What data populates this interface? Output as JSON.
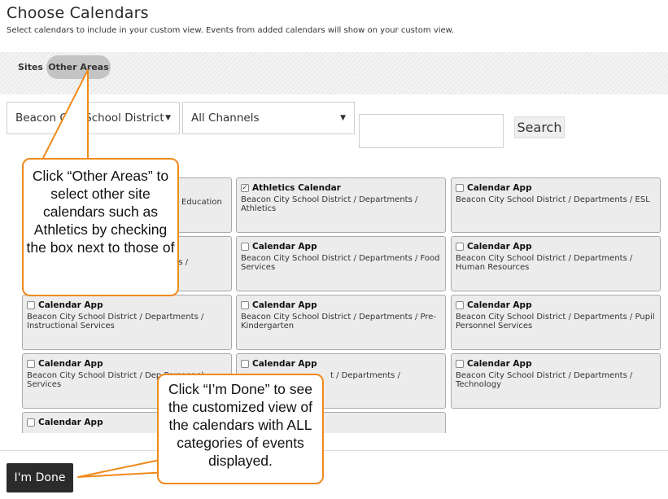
{
  "header": {
    "title": "Choose Calendars",
    "subtitle": "Select calendars to include in your custom view. Events from added calendars will show on your custom view."
  },
  "tabs": [
    {
      "label": "Sites",
      "active": false
    },
    {
      "label": "Other Areas",
      "active": true
    }
  ],
  "filters": {
    "site_select": "Beacon City School District",
    "channel_select": "All Channels",
    "search_value": "",
    "search_label": "Search"
  },
  "cards": [
    {
      "title": "",
      "path": "Education",
      "checked": false
    },
    {
      "title": "Athletics Calendar",
      "path": "Beacon City School District / Departments / Athletics",
      "checked": true
    },
    {
      "title": "Calendar App",
      "path": "Beacon City School District / Departments / ESL",
      "checked": false
    },
    {
      "title": "",
      "path": "ents /",
      "checked": false
    },
    {
      "title": "Calendar App",
      "path": "Beacon City School District / Departments / Food Services",
      "checked": false
    },
    {
      "title": "Calendar App",
      "path": "Beacon City School District / Departments / Human Resources",
      "checked": false
    },
    {
      "title": "Calendar App",
      "path": "Beacon City School District / Departments / Instructional Services",
      "checked": false
    },
    {
      "title": "Calendar App",
      "path": "Beacon City School District / Departments / Pre-Kindergarten",
      "checked": false
    },
    {
      "title": "Calendar App",
      "path": "Beacon City School District / Departments / Pupil Personnel Services",
      "checked": false
    },
    {
      "title": "Calendar App",
      "path": "Beacon City School District / Dep Personnel Services",
      "checked": false
    },
    {
      "title": "Calendar App",
      "path": "t / Departments /",
      "checked": false
    },
    {
      "title": "Calendar App",
      "path": "Beacon City School District / Departments / Technology",
      "checked": false
    },
    {
      "title": "Calendar App",
      "path": "",
      "checked": false
    }
  ],
  "footer": {
    "done_label": "I'm Done"
  },
  "callouts": {
    "other_areas": "Click “Other Areas” to select other site calendars such as Athletics by checking the box next to those of",
    "im_done": "Click “I’m Done” to see the customized view of the calendars with ALL categories of events displayed."
  },
  "colors": {
    "callout_border": "#f08a1c",
    "active_tab_bg": "#c4c4c4",
    "done_button_bg": "#2b2b2b",
    "card_bg": "#ececec"
  }
}
